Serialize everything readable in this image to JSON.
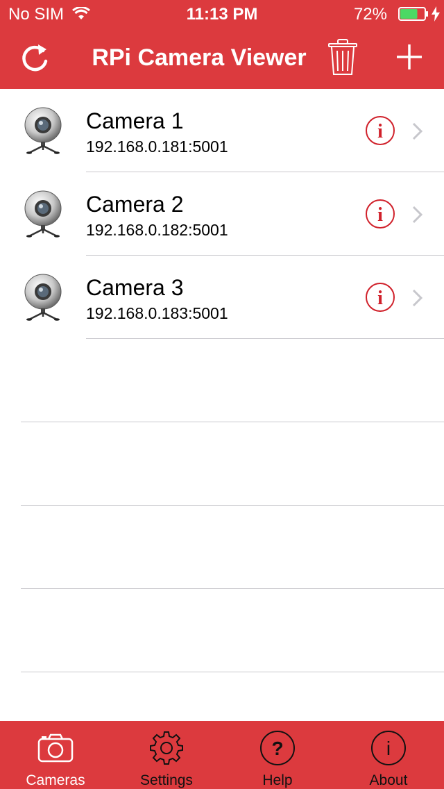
{
  "status": {
    "carrier": "No SIM",
    "time": "11:13 PM",
    "battery_percent": "72%",
    "battery_level": 0.72
  },
  "navbar": {
    "title": "RPi Camera Viewer",
    "left_icon": "refresh-icon",
    "right_icons": [
      "trash-icon",
      "add-icon"
    ]
  },
  "cameras": [
    {
      "name": "Camera 1",
      "address": "192.168.0.181:5001"
    },
    {
      "name": "Camera 2",
      "address": "192.168.0.182:5001"
    },
    {
      "name": "Camera 3",
      "address": "192.168.0.183:5001"
    }
  ],
  "tabs": [
    {
      "label": "Cameras",
      "icon": "camera-icon",
      "active": true
    },
    {
      "label": "Settings",
      "icon": "gear-icon",
      "active": false
    },
    {
      "label": "Help",
      "icon": "help-icon",
      "active": false
    },
    {
      "label": "About",
      "icon": "about-icon",
      "active": false
    }
  ],
  "colors": {
    "accent": "#dc3a3e",
    "info_icon": "#d0202a",
    "battery_fill": "#4cd964"
  }
}
